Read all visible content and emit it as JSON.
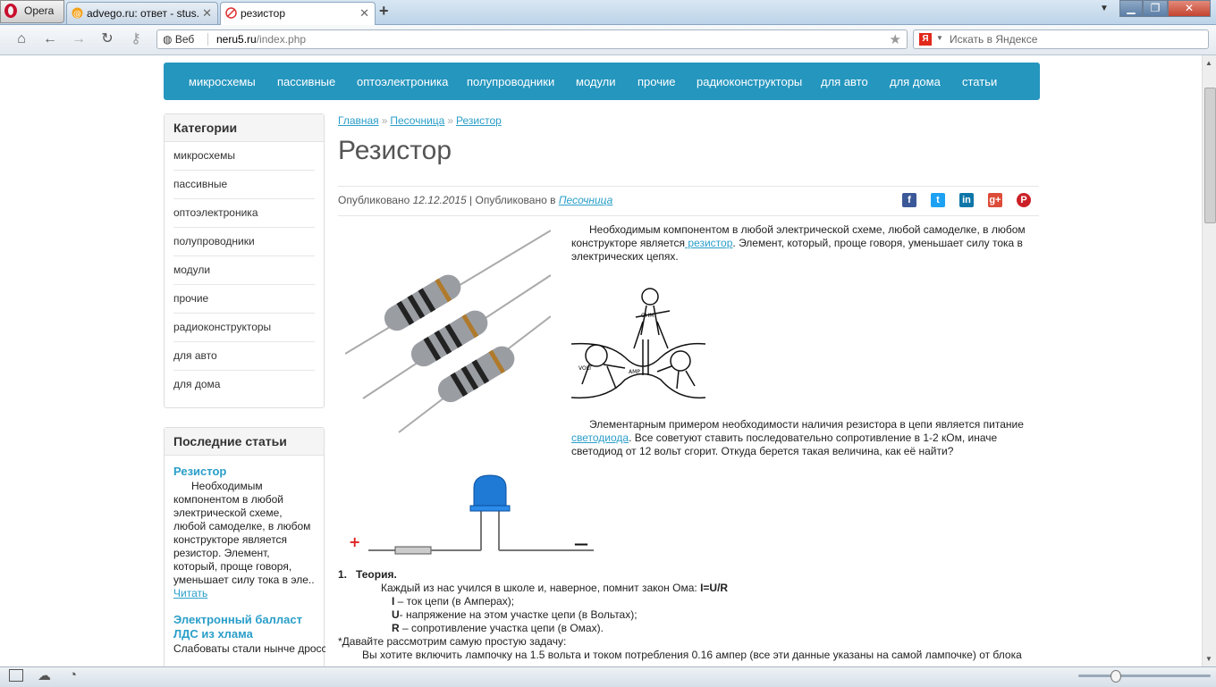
{
  "browser": {
    "opera_label": "Opera",
    "tabs": [
      {
        "label": "advego.ru: ответ - stus..."
      },
      {
        "label": "резистор"
      }
    ],
    "web_label": "Веб",
    "url_host": "neru5.ru",
    "url_path": "/index.php",
    "search_placeholder": "Искать в Яндексе",
    "yandex_letter": "Я"
  },
  "menu": [
    "микросхемы",
    "пассивные",
    "оптоэлектроника",
    "полупроводники",
    "модули",
    "прочие",
    "радиоконструкторы",
    "для авто",
    "для дома",
    "статьи"
  ],
  "sidebar": {
    "categories_title": "Категории",
    "categories": [
      "микросхемы",
      "пассивные",
      "оптоэлектроника",
      "полупроводники",
      "модули",
      "прочие",
      "радиоконструкторы",
      "для авто",
      "для дома"
    ],
    "recent_title": "Последние статьи",
    "recent": [
      {
        "title": "Резистор",
        "excerpt": "Необходимым компонентом в любой электрической схеме, любой самоделке, в любом конструкторе является резистор. Элемент, который, проще говоря, уменьшает силу тока в эле..",
        "more": "Читать"
      },
      {
        "title": "Электронный балласт ЛДС из хлама",
        "excerpt": "Слабоваты стали нынче дросселя ЛДС... Экономят"
      }
    ]
  },
  "article": {
    "breadcrumbs": [
      "Главная",
      "Песочница",
      "Резистор"
    ],
    "breadcrumb_sep": "»",
    "title": "Резистор",
    "meta_published": "Опубликовано",
    "meta_date": "12.12.2015",
    "meta_in": "| Опубликовано в",
    "meta_category": "Песочница",
    "p1_before": "Необходимым компонентом в любой электрической схеме, любой самоделке, в любом конструкторе является",
    "p1_link": " резистор",
    "p1_after": ". Элемент, который, проще говоря,  уменьшает силу тока в электрических цепях.",
    "p2_before": "Элементарным примером необходимости наличия резистора в цепи является питание",
    "p2_link": "светодиода",
    "p2_after": ". Все советуют ставить последовательно сопротивление в 1-2 кОм, иначе светодиод от 12 вольт сгорит. Откуда берется такая величина, как её найти?",
    "cartoon_labels": [
      "OHM",
      "VOLT",
      "AMP"
    ],
    "circuit_plus": "+",
    "circuit_minus": "—",
    "theory_num": "1.",
    "theory_title": "Теория.",
    "ohm_text": "Каждый из нас учился в школе и, наверное, помнит закон Ома:",
    "ohm_formula": "I=U/R",
    "i_sym": "I",
    "i_desc": " – ток цепи (в Амперах);",
    "u_sym": "U",
    "u_desc": "- напряжение на этом участке цепи (в Вольтах);",
    "r_sym": "R",
    "r_desc": " – сопротивление участка цепи (в Омах).",
    "task_text": "*Давайте рассмотрим самую простую задачу:",
    "task_body": "Вы хотите включить лампочку на 1.5 вольта и током потребления 0.16 ампер (все эти данные указаны на самой лампочке) от  блока"
  },
  "colors": {
    "menu_bg": "#2596be",
    "link": "#2a9ec9"
  }
}
